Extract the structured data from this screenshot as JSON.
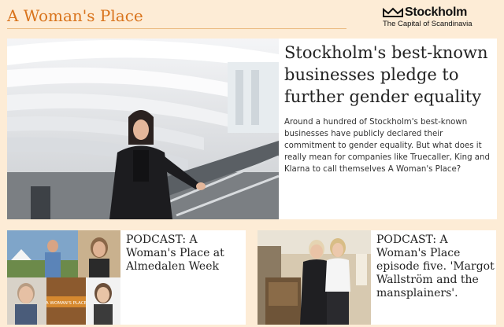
{
  "header": {
    "site_title": "A Woman's Place",
    "brand_name": "Stockholm",
    "brand_tagline": "The Capital of Scandinavia"
  },
  "featured": {
    "headline": "Stockholm's best-known businesses pledge to further gender equality",
    "summary": "Around a hundred of Stockholm's best-known businesses have publicly declared their commitment to gender equality. But what does it really mean for companies like Truecaller, King and Klarna to call themselves A Woman's Place?"
  },
  "cards": [
    {
      "title": "PODCAST: A Woman's Place at Almedalen Week",
      "image_caption": "A WOMAN'S PLACE"
    },
    {
      "title": "PODCAST: A Woman's Place episode five. 'Margot Wallström and the mansplainers'."
    }
  ],
  "colors": {
    "accent": "#d9741d",
    "background": "#fdecd6"
  }
}
